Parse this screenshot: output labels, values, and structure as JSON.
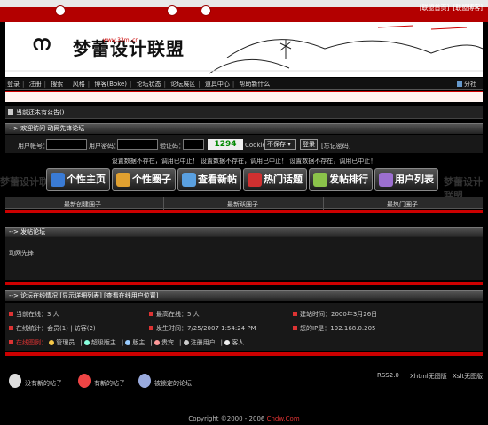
{
  "top": {
    "links": [
      "[联盟首页]",
      "[联盟博客]"
    ]
  },
  "logo": {
    "text": "梦蕾设计联盟",
    "url": "www.33ml.cn"
  },
  "nav": {
    "items": [
      "登录",
      "注册",
      "搜索",
      "风格",
      "博客(Boke)",
      "论坛状态",
      "论坛展区",
      "道具中心",
      "帮助新什么"
    ],
    "share": "分社"
  },
  "announce": "当前还未有公告()",
  "welcome": "--> 欢迎访问 动网先锋论坛",
  "login": {
    "user_label": "用户帐号：",
    "pass_label": "用户密码：",
    "code_label": "验证码：",
    "captcha": "1294",
    "cookie_label": "Cookie",
    "cookie_value": "不保存",
    "login_btn": "登录",
    "forgot": "[忘记密码]"
  },
  "status_row": "设置数据不存在，调用已中止！ 设置数据不存在，调用已中止！ 设置数据不存在，调用已中止！",
  "icon_buttons": [
    "个性主页",
    "个性圈子",
    "查看新帖",
    "热门话题",
    "发帖排行",
    "用户列表"
  ],
  "watermark": "梦蕾设计联盟",
  "columns": [
    "最新创建圈子",
    "最新跃圈子",
    "最热门圈子"
  ],
  "moderator_bar": "--> 发帖论坛",
  "forum_name": "动网先锋",
  "online_bar": "--> 论坛在线情况 [显示详细列表] [查看在线用户位置]",
  "online": {
    "current": "当前在线：3 人",
    "max": "最高在线：5 人",
    "founded": "建站时间：2000年3月26日",
    "detail": "在线统计：会员(1) | 访客(2)",
    "time": "发生时间：7/25/2007 1:54:24 PM",
    "ip": "您的IP是：192.168.0.205"
  },
  "legend": {
    "title": "在线图例：",
    "items": [
      "管理员",
      "超级版主",
      "版主",
      "贵宾",
      "注册用户",
      "客人"
    ]
  },
  "bottom": {
    "new_posts": "没有新的帖子",
    "has_new": "有新的帖子",
    "locked": "被锁定的论坛",
    "rss": "RSS2.0",
    "xhtml": "Xhtml无图版",
    "xslt": "Xslt无图版"
  },
  "copyright": {
    "text": "Copyright ©2000 - 2006",
    "brand": "Cndw.Com"
  },
  "colors": {
    "accent": "#cc0000",
    "bg": "#000000"
  }
}
